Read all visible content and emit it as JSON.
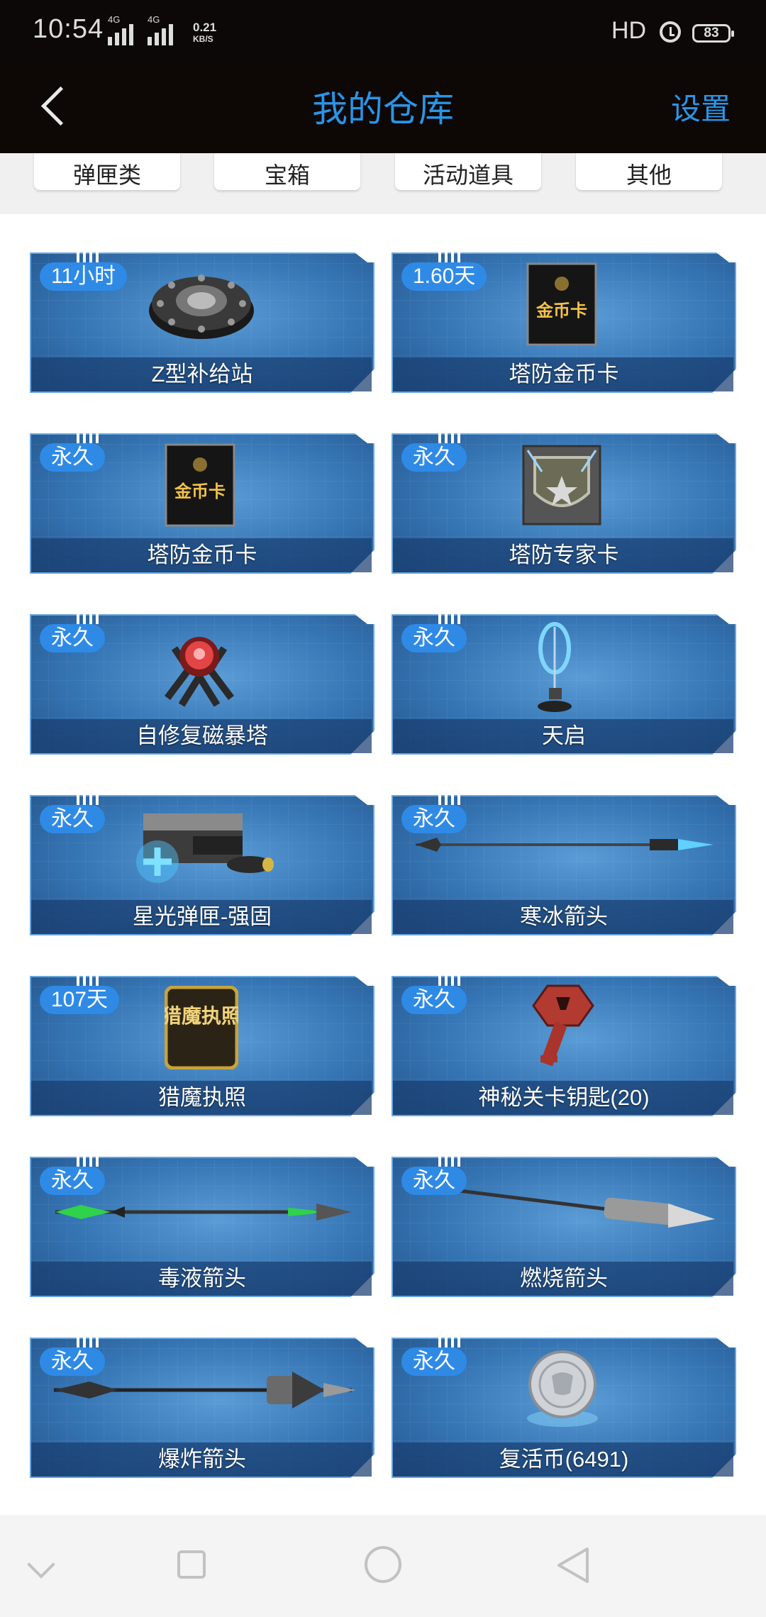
{
  "status_bar": {
    "time": "10:54",
    "net1": "4G",
    "net2": "4G",
    "speed_value": "0.21",
    "speed_unit": "KB/S",
    "hd": "HD",
    "battery": "83"
  },
  "header": {
    "title": "我的仓库",
    "settings": "设置"
  },
  "tabs": [
    {
      "label": "弹匣类"
    },
    {
      "label": "宝箱"
    },
    {
      "label": "活动道具"
    },
    {
      "label": "其他"
    }
  ],
  "items": [
    {
      "badge": "11小时",
      "name": "Z型补给站",
      "icon": "supply-station-icon"
    },
    {
      "badge": "1.60天",
      "name": "塔防金币卡",
      "icon": "gold-card-icon"
    },
    {
      "badge": "永久",
      "name": "塔防金币卡",
      "icon": "gold-card-icon"
    },
    {
      "badge": "永久",
      "name": "塔防专家卡",
      "icon": "expert-card-icon"
    },
    {
      "badge": "永久",
      "name": "自修复磁暴塔",
      "icon": "tesla-tower-icon"
    },
    {
      "badge": "永久",
      "name": "天启",
      "icon": "apocalypse-icon"
    },
    {
      "badge": "永久",
      "name": "星光弹匣-强固",
      "icon": "magazine-icon"
    },
    {
      "badge": "永久",
      "name": "寒冰箭头",
      "icon": "ice-arrow-icon"
    },
    {
      "badge": "107天",
      "name": "猎魔执照",
      "icon": "license-icon"
    },
    {
      "badge": "永久",
      "name": "神秘关卡钥匙(20)",
      "icon": "key-icon"
    },
    {
      "badge": "永久",
      "name": "毒液箭头",
      "icon": "venom-arrow-icon"
    },
    {
      "badge": "永久",
      "name": "燃烧箭头",
      "icon": "fire-arrow-icon"
    },
    {
      "badge": "永久",
      "name": "爆炸箭头",
      "icon": "explosive-arrow-icon"
    },
    {
      "badge": "永久",
      "name": "复活币(6491)",
      "icon": "revive-coin-icon"
    }
  ],
  "card_art": {
    "gold_card_top": "金币卡",
    "license_text": "猎魔执照"
  },
  "colors": {
    "accent": "#2a95e8",
    "header_bg": "#0d0806",
    "card_blue": "#3574b3",
    "badge_blue": "#2f8ae6"
  }
}
